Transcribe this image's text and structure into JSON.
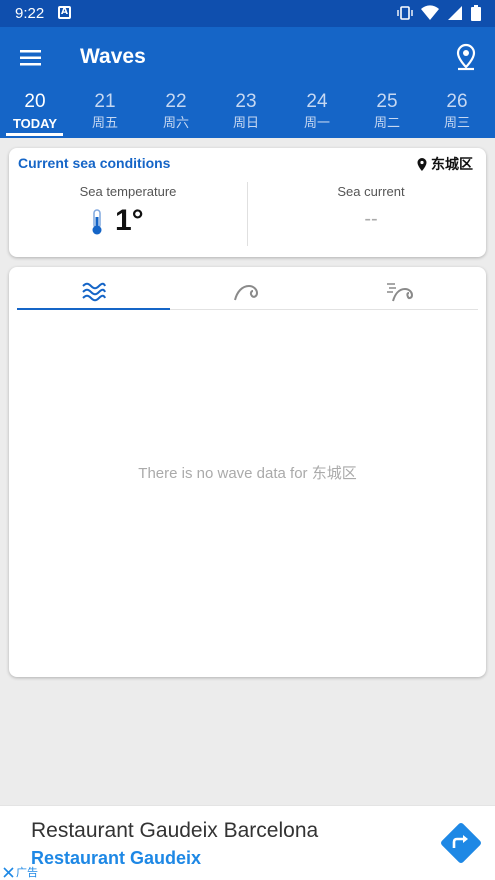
{
  "status": {
    "time": "9:22",
    "notification_letter": "A"
  },
  "app": {
    "title": "Waves"
  },
  "days": [
    {
      "num": "20",
      "label": "TODAY"
    },
    {
      "num": "21",
      "label": "周五"
    },
    {
      "num": "22",
      "label": "周六"
    },
    {
      "num": "23",
      "label": "周日"
    },
    {
      "num": "24",
      "label": "周一"
    },
    {
      "num": "25",
      "label": "周二"
    },
    {
      "num": "26",
      "label": "周三"
    }
  ],
  "conditions": {
    "title": "Current sea conditions",
    "location": "东城区",
    "sea_temperature_label": "Sea temperature",
    "sea_temperature_value": "1°",
    "sea_current_label": "Sea current",
    "sea_current_value": "--"
  },
  "waves": {
    "tabs": [
      "waves-icon",
      "swell-icon",
      "wind-wave-icon"
    ],
    "active_tab": 0,
    "empty_message": "There is no wave data for 东城区"
  },
  "ad": {
    "title": "Restaurant Gaudeix Barcelona",
    "subtitle": "Restaurant Gaudeix",
    "badge": "广告"
  },
  "colors": {
    "primary": "#1565c7",
    "status_bar": "#0f4fae",
    "accent": "#1e88e5"
  }
}
